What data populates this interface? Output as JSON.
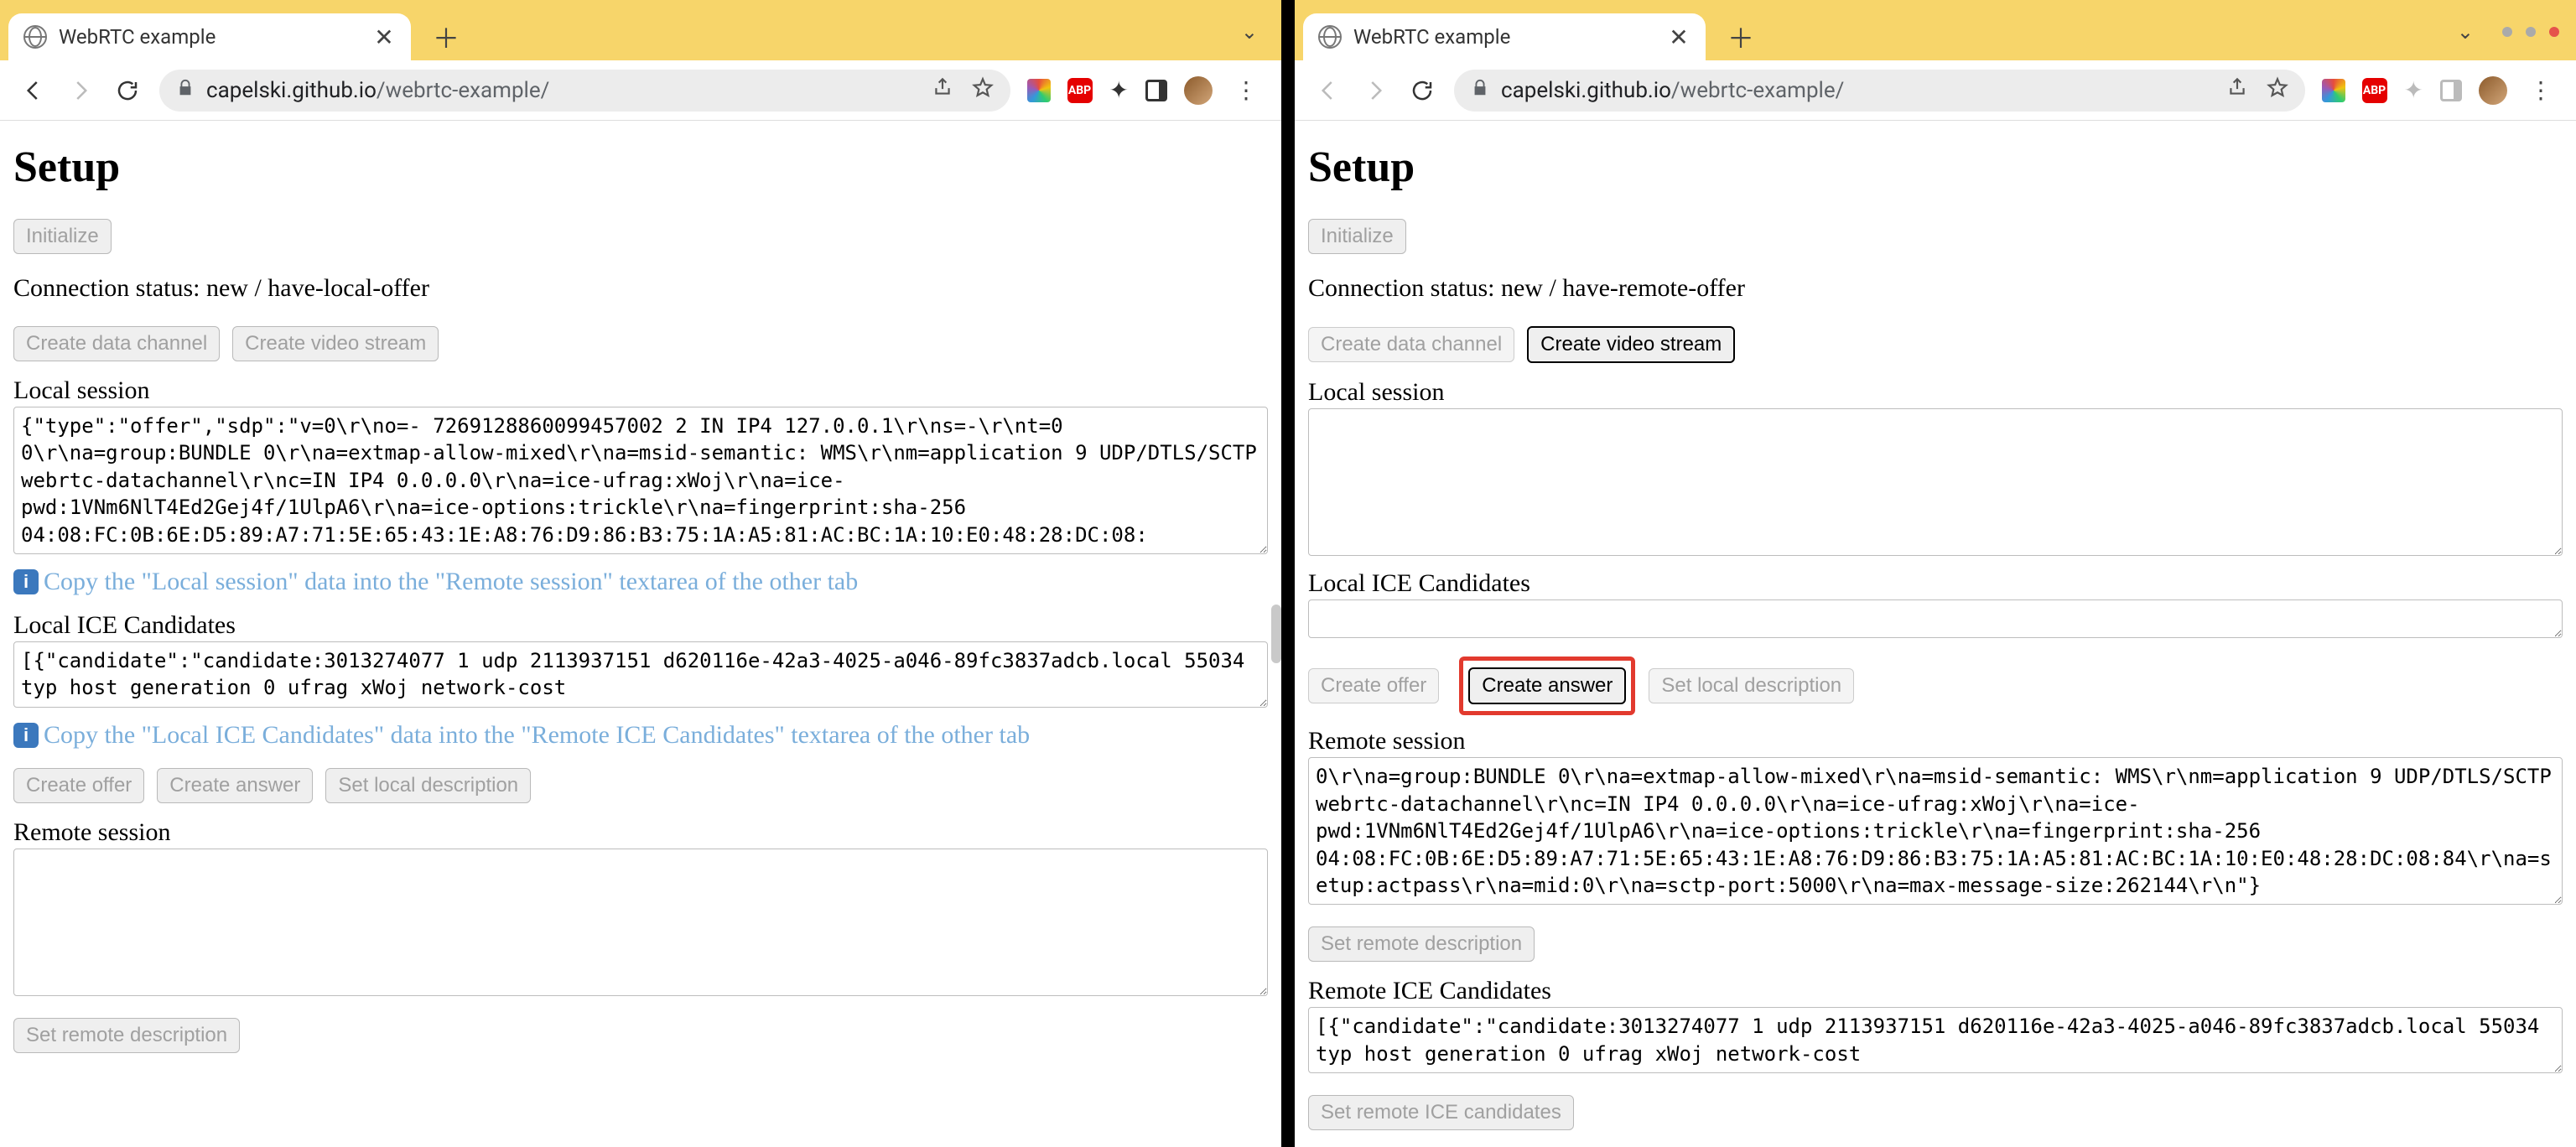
{
  "left": {
    "tab_title": "WebRTC example",
    "url_host": "capelski.github.io",
    "url_path": "/webrtc-example/",
    "heading": "Setup",
    "initialize_label": "Initialize",
    "status_prefix": "Connection status: ",
    "status_value": "new / have-local-offer",
    "create_data_channel": "Create data channel",
    "create_video_stream": "Create video stream",
    "local_session_label": "Local session",
    "local_session_value": "{\"type\":\"offer\",\"sdp\":\"v=0\\r\\no=- 7269128860099457002 2 IN IP4 127.0.0.1\\r\\ns=-\\r\\nt=0 0\\r\\na=group:BUNDLE 0\\r\\na=extmap-allow-mixed\\r\\na=msid-semantic: WMS\\r\\nm=application 9 UDP/DTLS/SCTP webrtc-datachannel\\r\\nc=IN IP4 0.0.0.0\\r\\na=ice-ufrag:xWoj\\r\\na=ice-pwd:1VNm6NlT4Ed2Gej4f/1UlpA6\\r\\na=ice-options:trickle\\r\\na=fingerprint:sha-256 04:08:FC:0B:6E:D5:89:A7:71:5E:65:43:1E:A8:76:D9:86:B3:75:1A:A5:81:AC:BC:1A:10:E0:48:28:DC:08:",
    "hint_session": "Copy the \"Local session\" data into the \"Remote session\" textarea of the other tab",
    "local_ice_label": "Local ICE Candidates",
    "local_ice_value": "[{\"candidate\":\"candidate:3013274077 1 udp 2113937151 d620116e-42a3-4025-a046-89fc3837adcb.local 55034 typ host generation 0 ufrag xWoj network-cost",
    "hint_ice": "Copy the \"Local ICE Candidates\" data into the \"Remote ICE Candidates\" textarea of the other tab",
    "create_offer": "Create offer",
    "create_answer": "Create answer",
    "set_local_desc": "Set local description",
    "remote_session_label": "Remote session",
    "remote_session_value": "",
    "set_remote_desc": "Set remote description",
    "abp_label": "ABP"
  },
  "right": {
    "tab_title": "WebRTC example",
    "url_host": "capelski.github.io",
    "url_path": "/webrtc-example/",
    "heading": "Setup",
    "initialize_label": "Initialize",
    "status_prefix": "Connection status: ",
    "status_value": "new / have-remote-offer",
    "create_data_channel": "Create data channel",
    "create_video_stream": "Create video stream",
    "local_session_label": "Local session",
    "local_session_value": "",
    "local_ice_label": "Local ICE Candidates",
    "local_ice_value": "",
    "create_offer": "Create offer",
    "create_answer": "Create answer",
    "set_local_desc": "Set local description",
    "remote_session_label": "Remote session",
    "remote_session_value": "0\\r\\na=group:BUNDLE 0\\r\\na=extmap-allow-mixed\\r\\na=msid-semantic: WMS\\r\\nm=application 9 UDP/DTLS/SCTP webrtc-datachannel\\r\\nc=IN IP4 0.0.0.0\\r\\na=ice-ufrag:xWoj\\r\\na=ice-pwd:1VNm6NlT4Ed2Gej4f/1UlpA6\\r\\na=ice-options:trickle\\r\\na=fingerprint:sha-256 04:08:FC:0B:6E:D5:89:A7:71:5E:65:43:1E:A8:76:D9:86:B3:75:1A:A5:81:AC:BC:1A:10:E0:48:28:DC:08:84\\r\\na=setup:actpass\\r\\na=mid:0\\r\\na=sctp-port:5000\\r\\na=max-message-size:262144\\r\\n\"}",
    "set_remote_desc": "Set remote description",
    "remote_ice_label": "Remote ICE Candidates",
    "remote_ice_value": "[{\"candidate\":\"candidate:3013274077 1 udp 2113937151 d620116e-42a3-4025-a046-89fc3837adcb.local 55034 typ host generation 0 ufrag xWoj network-cost",
    "set_remote_ice": "Set remote ICE candidates",
    "abp_label": "ABP"
  }
}
